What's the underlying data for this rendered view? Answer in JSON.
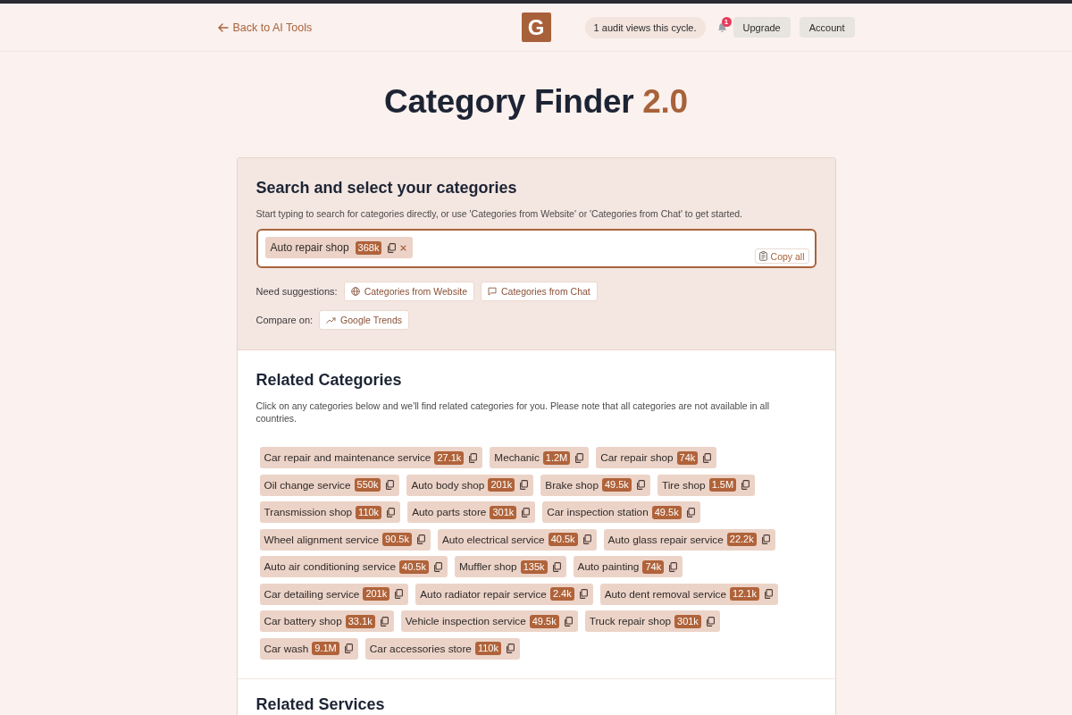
{
  "header": {
    "back_link": "Back to AI Tools",
    "logo": "G",
    "audit_notice": "1 audit views this cycle.",
    "notifications": {
      "count": "1"
    },
    "buttons": [
      "Upgrade",
      "Account"
    ]
  },
  "page_title": {
    "title": "Category Finder",
    "version": "2.0"
  },
  "search_panel": {
    "heading": "Search and select your categories",
    "description": "Start typing to search for categories directly, or use 'Categories from Website' or 'Categories from Chat' to get started.",
    "field": {
      "chips": [
        {
          "label": "Auto repair shop",
          "volume": "368k"
        }
      ],
      "copy_all": "Copy all"
    },
    "suggestions": {
      "label": "Need suggestions:",
      "buttons": [
        {
          "label": "Categories from Website",
          "kind": "website"
        },
        {
          "label": "Categories from Chat",
          "kind": "chat"
        }
      ]
    },
    "compare": {
      "label": "Compare on:",
      "buttons": [
        {
          "label": "Google Trends",
          "kind": "trends"
        }
      ]
    }
  },
  "related_categories": {
    "heading": "Related Categories",
    "description": "Click on any categories below and we'll find related categories for you. Please note that all categories are not available in all countries.",
    "tags": [
      {
        "label": "Car repair and maintenance service",
        "volume": "27.1k"
      },
      {
        "label": "Mechanic",
        "volume": "1.2M"
      },
      {
        "label": "Car repair shop",
        "volume": "74k"
      },
      {
        "label": "Oil change service",
        "volume": "550k"
      },
      {
        "label": "Auto body shop",
        "volume": "201k"
      },
      {
        "label": "Brake shop",
        "volume": "49.5k"
      },
      {
        "label": "Tire shop",
        "volume": "1.5M"
      },
      {
        "label": "Transmission shop",
        "volume": "110k"
      },
      {
        "label": "Auto parts store",
        "volume": "301k"
      },
      {
        "label": "Car inspection station",
        "volume": "49.5k"
      },
      {
        "label": "Wheel alignment service",
        "volume": "90.5k"
      },
      {
        "label": "Auto electrical service",
        "volume": "40.5k"
      },
      {
        "label": "Auto glass repair service",
        "volume": "22.2k"
      },
      {
        "label": "Auto air conditioning service",
        "volume": "40.5k"
      },
      {
        "label": "Muffler shop",
        "volume": "135k"
      },
      {
        "label": "Auto painting",
        "volume": "74k"
      },
      {
        "label": "Car detailing service",
        "volume": "201k"
      },
      {
        "label": "Auto radiator repair service",
        "volume": "2.4k"
      },
      {
        "label": "Auto dent removal service",
        "volume": "12.1k"
      },
      {
        "label": "Car battery shop",
        "volume": "33.1k"
      },
      {
        "label": "Vehicle inspection service",
        "volume": "49.5k"
      },
      {
        "label": "Truck repair shop",
        "volume": "301k"
      },
      {
        "label": "Car wash",
        "volume": "9.1M"
      },
      {
        "label": "Car accessories store",
        "volume": "110k"
      }
    ]
  },
  "related_services": {
    "heading": "Related Services"
  }
}
